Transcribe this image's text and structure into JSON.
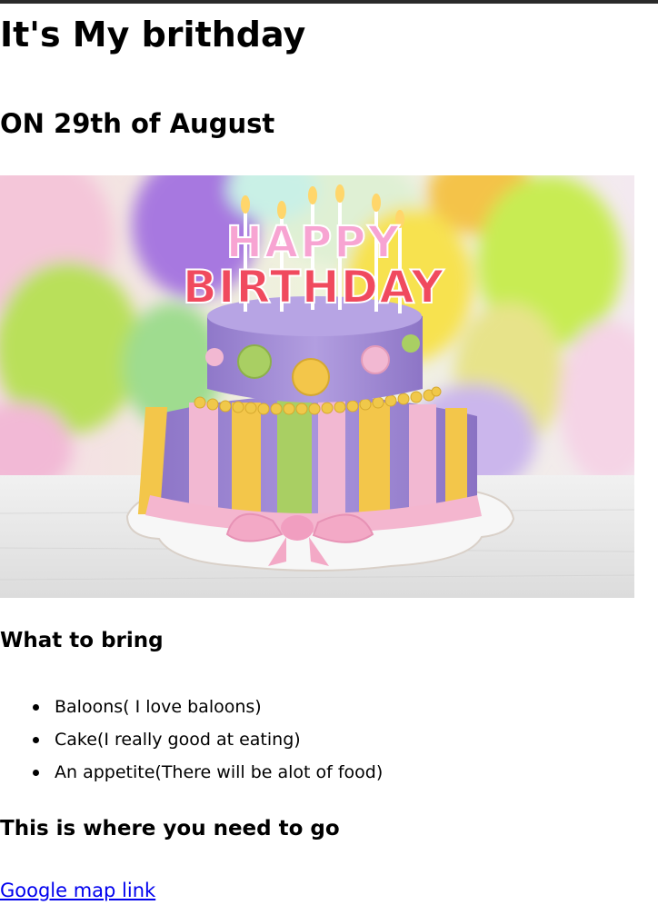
{
  "page": {
    "title": "It's My brithday",
    "subtitle": "ON 29th of August"
  },
  "image": {
    "alt": "Happy Birthday cake with balloons",
    "cake_text_line1": "HAPPY",
    "cake_text_line2": "BIRTHDAY"
  },
  "bring": {
    "heading": "What to bring",
    "items": [
      "Baloons( I love baloons)",
      "Cake(I really good at eating)",
      "An appetite(There will be alot of food)"
    ]
  },
  "directions": {
    "heading": "This is where you need to go",
    "link_label": "Google map link"
  },
  "colors": {
    "link": "#0000ee",
    "cake_purple": "#a58fd6",
    "cake_pink": "#f2b8d2",
    "cake_yellow": "#f3c64a",
    "cake_green": "#a9cf63"
  }
}
